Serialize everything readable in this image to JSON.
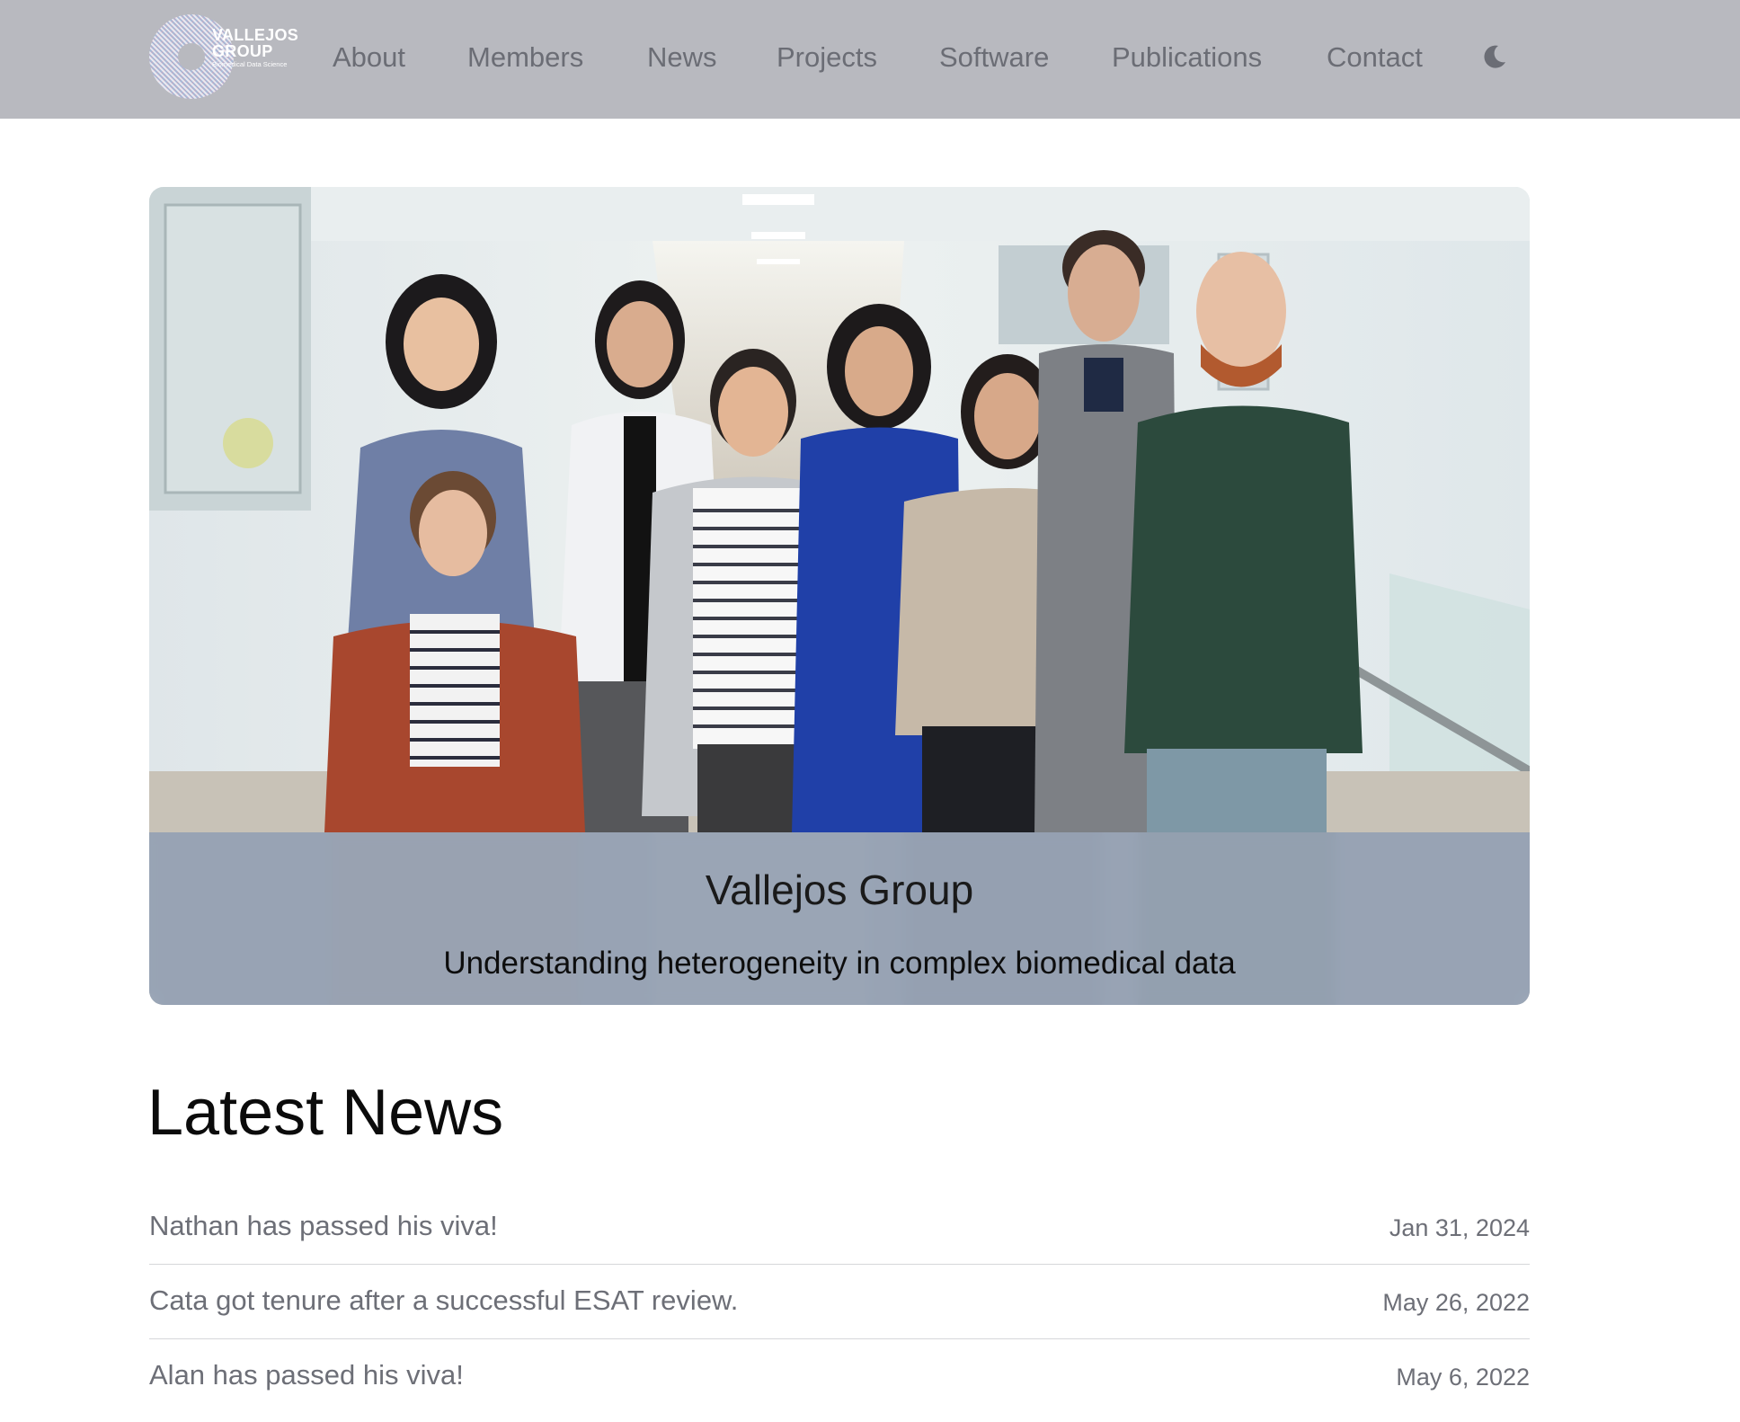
{
  "brand": {
    "line1": "VALLEJOS",
    "line2": "GROUP",
    "line3": "Biomedical Data Science"
  },
  "nav": {
    "items": [
      {
        "label": "About"
      },
      {
        "label": "Members"
      },
      {
        "label": "News"
      },
      {
        "label": "Projects"
      },
      {
        "label": "Software"
      },
      {
        "label": "Publications"
      },
      {
        "label": "Contact"
      }
    ],
    "theme_toggle_icon": "moon-icon"
  },
  "hero": {
    "title": "Vallejos Group",
    "subtitle": "Understanding heterogeneity in complex biomedical data"
  },
  "news": {
    "heading": "Latest News",
    "items": [
      {
        "title": "Nathan has passed his viva!",
        "date": "Jan 31, 2024"
      },
      {
        "title": "Cata got tenure after a successful ESAT review.",
        "date": "May 26, 2022"
      },
      {
        "title": "Alan has passed his viva!",
        "date": "May 6, 2022"
      }
    ]
  },
  "colors": {
    "navbar_bg": "#b8b9bf",
    "nav_text": "#6b6d75",
    "caption_bg": "#94a0b2",
    "divider": "#d6d7da"
  }
}
